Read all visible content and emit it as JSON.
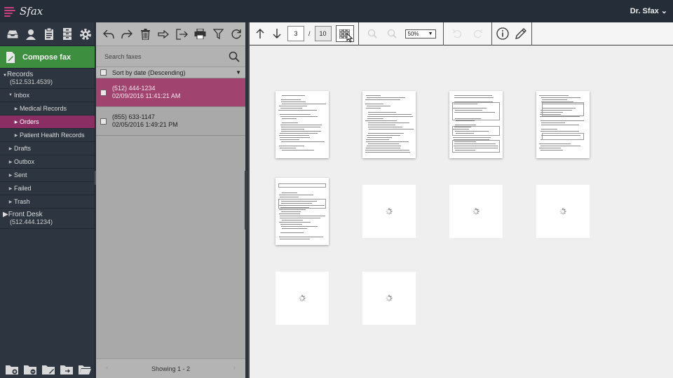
{
  "app": {
    "logo_text": "Sfax",
    "user_label": "Dr. Sfax ⌄"
  },
  "sidebar": {
    "icons": [
      "inbox-icon",
      "contacts-icon",
      "clipboard-icon",
      "cabinet-icon",
      "settings-icon"
    ],
    "compose_label": "Compose fax",
    "records": {
      "name": "Records",
      "number": "(512.531.4539)"
    },
    "inbox_label": "Inbox",
    "inbox_children": [
      "Medical Records",
      "Orders",
      "Patient Health Records"
    ],
    "folders": [
      "Drafts",
      "Outbox",
      "Sent",
      "Failed",
      "Trash"
    ],
    "front_desk": {
      "name": "Front Desk",
      "number": "(512.444.1234)"
    },
    "bottom_icons": [
      "new-folder-icon",
      "remove-folder-icon",
      "edit-folder-icon",
      "move-folder-icon",
      "open-folder-icon"
    ]
  },
  "list": {
    "search_placeholder": "Search faxes",
    "sort_label": "Sort by date (Descending)",
    "items": [
      {
        "number": "(512) 444-1234",
        "date": "02/09/2016 11:41:21 AM"
      },
      {
        "number": "(855) 633-1147",
        "date": "02/05/2016 1:49:21 PM"
      }
    ],
    "footer": "Showing 1 - 2",
    "prev": "‹",
    "next": "›"
  },
  "viewer": {
    "current_page": "3",
    "page_separator": "/",
    "total_pages": "10",
    "zoom": "50%"
  },
  "colors": {
    "accent": "#8b2e64",
    "compose": "#3e8e40",
    "topbar": "#252d38"
  }
}
